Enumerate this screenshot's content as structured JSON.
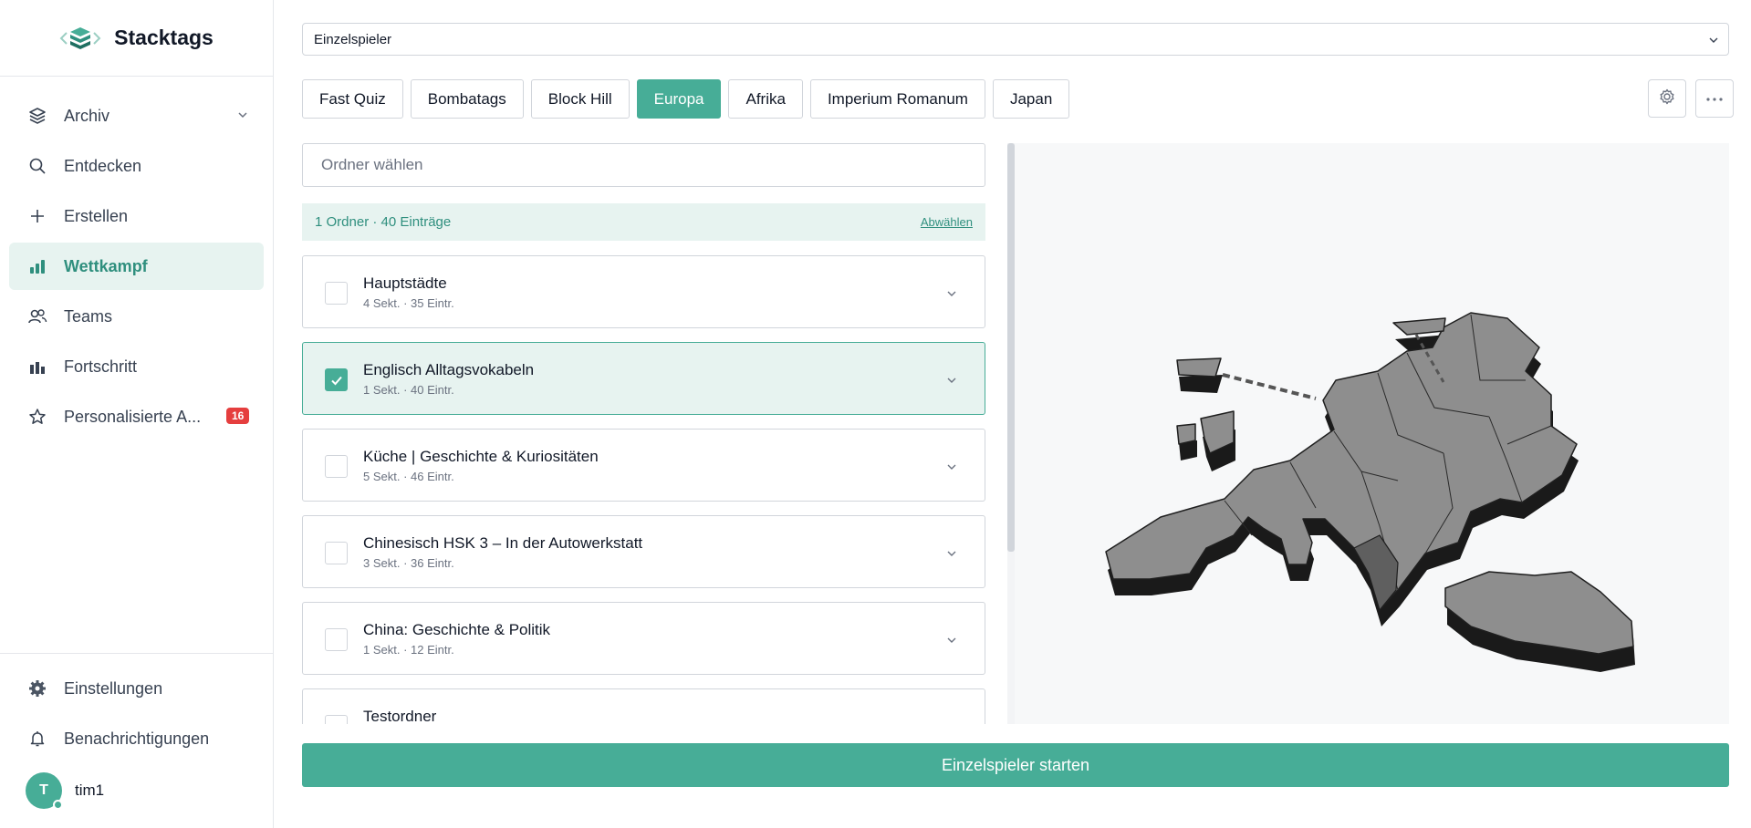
{
  "app": {
    "title": "Stacktags"
  },
  "sidebar": {
    "items": [
      {
        "label": "Archiv",
        "icon": "layers-icon"
      },
      {
        "label": "Entdecken",
        "icon": "search-icon"
      },
      {
        "label": "Erstellen",
        "icon": "plus-icon"
      },
      {
        "label": "Wettkampf",
        "icon": "bar-chart-icon",
        "active": true
      },
      {
        "label": "Teams",
        "icon": "users-icon"
      },
      {
        "label": "Fortschritt",
        "icon": "progress-chart-icon"
      },
      {
        "label": "Personalisierte A...",
        "icon": "star-icon",
        "badge": "16"
      }
    ],
    "bottom": [
      {
        "label": "Einstellungen",
        "icon": "gear-icon"
      },
      {
        "label": "Benachrichtigungen",
        "icon": "bell-icon"
      }
    ],
    "user": {
      "initial": "T",
      "name": "tim1"
    }
  },
  "mode": {
    "selected": "Einzelspieler"
  },
  "tabs": [
    {
      "label": "Fast Quiz"
    },
    {
      "label": "Bombatags"
    },
    {
      "label": "Block Hill"
    },
    {
      "label": "Europa",
      "active": true
    },
    {
      "label": "Afrika"
    },
    {
      "label": "Imperium Romanum"
    },
    {
      "label": "Japan"
    }
  ],
  "folder": {
    "placeholder": "Ordner wählen"
  },
  "summary": {
    "text": "1 Ordner · 40 Einträge",
    "deselect": "Abwählen"
  },
  "folders": [
    {
      "title": "Hauptstädte",
      "meta": "4 Sekt. · 35 Eintr.",
      "checked": false
    },
    {
      "title": "Englisch Alltagsvokabeln",
      "meta": "1 Sekt. · 40 Eintr.",
      "checked": true
    },
    {
      "title": "Küche | Geschichte & Kuriositäten",
      "meta": "5 Sekt. · 46 Eintr.",
      "checked": false
    },
    {
      "title": "Chinesisch HSK 3 – In der Autowerkstatt",
      "meta": "3 Sekt. · 36 Eintr.",
      "checked": false
    },
    {
      "title": "China: Geschichte & Politik",
      "meta": "1 Sekt. · 12 Eintr.",
      "checked": false
    },
    {
      "title": "Testordner",
      "meta": "",
      "checked": false
    }
  ],
  "actions": {
    "start": "Einzelspieler starten"
  },
  "colors": {
    "accent": "#47ad97",
    "accent_light": "#e7f3f0",
    "badge": "#e53e3e"
  }
}
